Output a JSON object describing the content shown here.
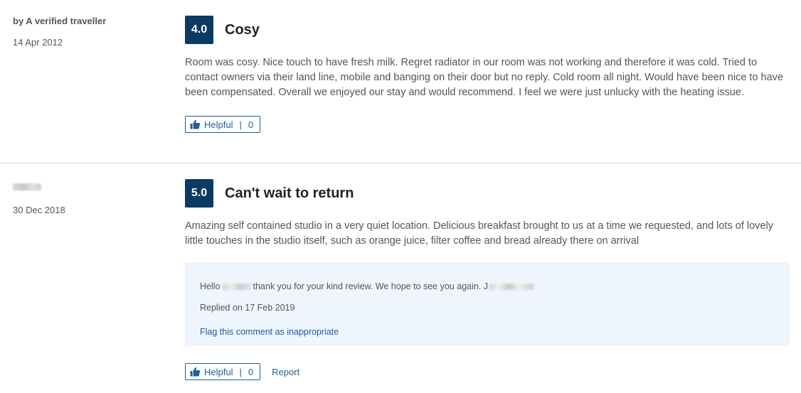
{
  "reviews": [
    {
      "author": "by A verified traveller",
      "date": "14 Apr 2012",
      "rating": "4.0",
      "title": "Cosy",
      "body": "Room was cosy. Nice touch to have fresh milk. Regret radiator in our room was not working and therefore it was cold. Tried to contact owners via their land line, mobile and banging on their door but no reply. Cold room all night. Would have been nice to have been compensated. Overall we enjoyed our stay and would recommend. I feel we were just unlucky with the heating issue.",
      "helpful_label": "Helpful",
      "helpful_count": "0"
    },
    {
      "author_redacted": true,
      "date": "30 Dec 2018",
      "rating": "5.0",
      "title": "Can't wait to return",
      "body": "Amazing self contained studio in a very quiet location. Delicious breakfast brought to us at a time we requested, and lots of lovely little touches in the studio itself, such as orange juice, filter coffee and bread already there on arrival",
      "reply": {
        "greeting": "Hello",
        "message": "thank you for your kind review. We hope to see you again. J",
        "replied_on": "Replied on 17 Feb 2019",
        "flag_label": "Flag this comment as inappropriate"
      },
      "helpful_label": "Helpful",
      "helpful_count": "0",
      "report_label": "Report"
    }
  ],
  "icons": {
    "helpful": "thumbs-up-icon"
  },
  "colors": {
    "rating_badge": "#0b3a63",
    "link": "#1f5e98",
    "reply_bg": "#eef5fc"
  }
}
